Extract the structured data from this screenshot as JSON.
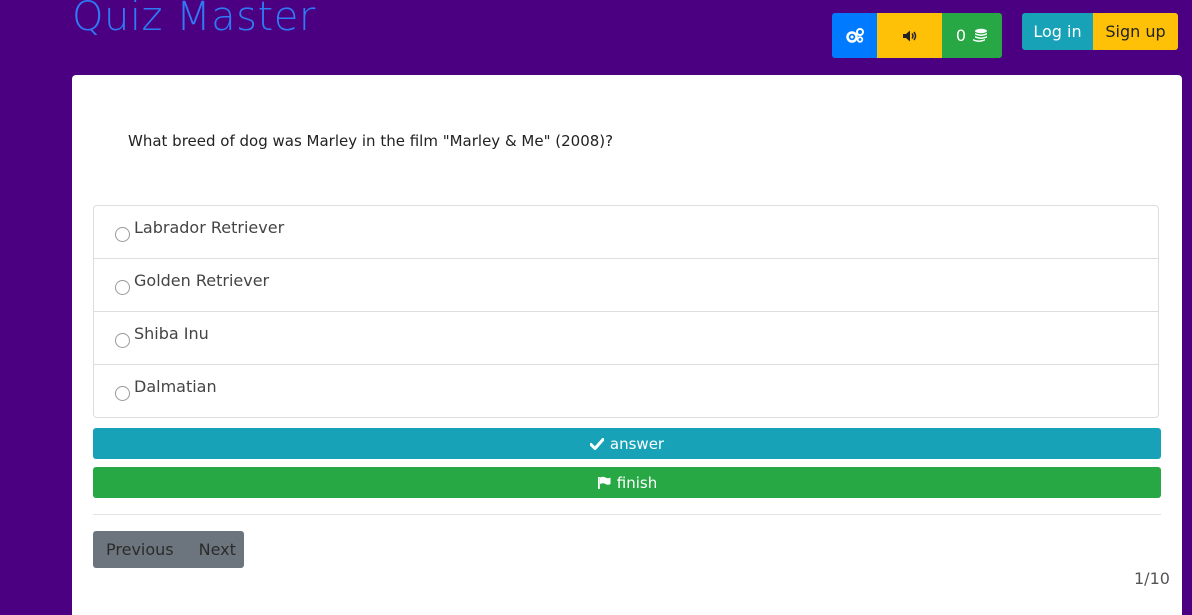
{
  "app": {
    "title": "Quiz Master"
  },
  "toolbar": {
    "settings_icon": "gears-icon",
    "sound_icon": "volume-icon",
    "coins_count": "0",
    "coins_icon": "coins-icon"
  },
  "auth": {
    "login_label": "Log in",
    "signup_label": "Sign up"
  },
  "quiz": {
    "question": "What breed of dog was Marley in the film \"Marley & Me\" (2008)?",
    "options": [
      {
        "label": "Labrador Retriever",
        "selected": false
      },
      {
        "label": "Golden Retriever",
        "selected": false
      },
      {
        "label": "Shiba Inu",
        "selected": false
      },
      {
        "label": "Dalmatian",
        "selected": false
      }
    ],
    "answer_label": "answer",
    "finish_label": "finish",
    "progress_text": "1/10"
  },
  "pagination": {
    "previous_label": "Previous",
    "next_label": "Next"
  },
  "colors": {
    "background": "#4b0082",
    "brand": "#2f7bf6",
    "primary": "#007bff",
    "warning": "#ffc107",
    "success": "#28a745",
    "info": "#17a2b8",
    "secondary": "#6c757d"
  }
}
